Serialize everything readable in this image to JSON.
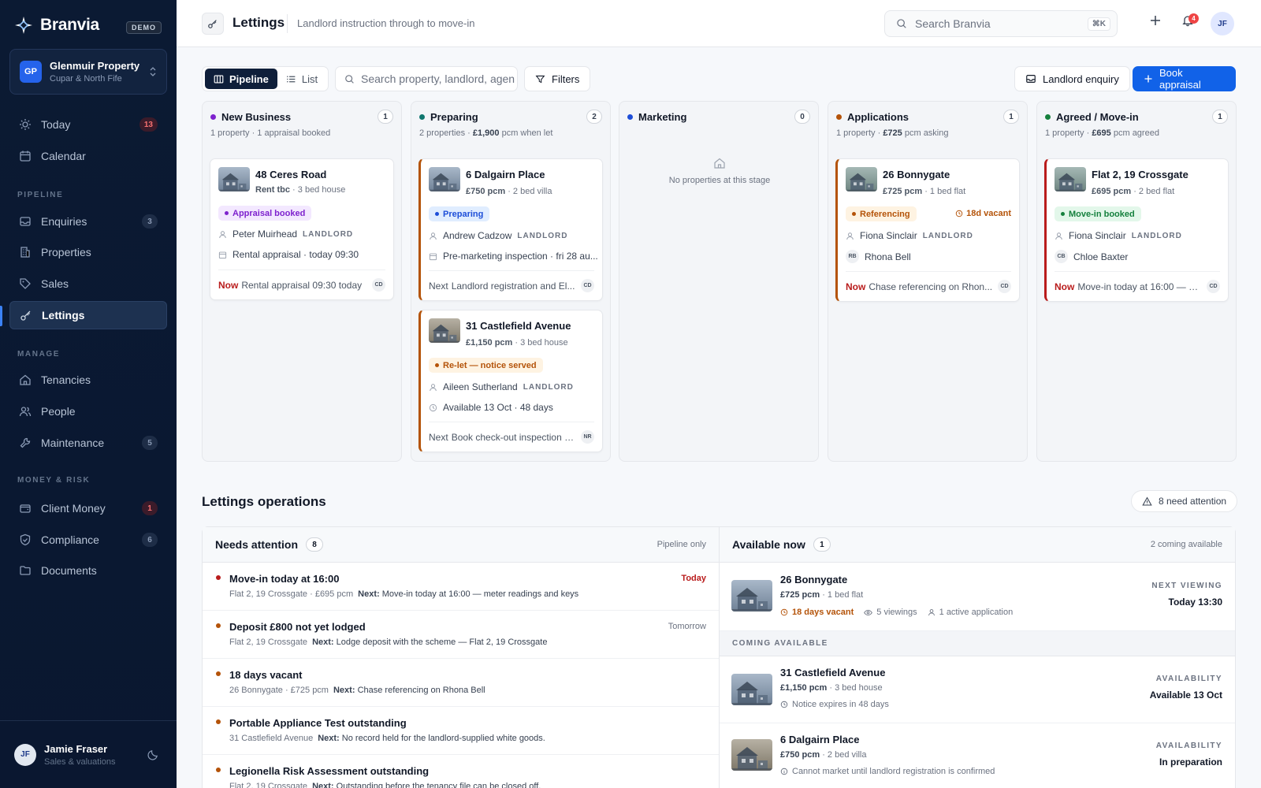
{
  "brand": {
    "name": "Branvia",
    "tag": "DEMO"
  },
  "org": {
    "initials": "GP",
    "name": "Glenmuir Property",
    "sub": "Cupar & North Fife"
  },
  "nav": {
    "today": {
      "label": "Today",
      "badge": "13"
    },
    "calendar": {
      "label": "Calendar"
    },
    "pipeline_header": "PIPELINE",
    "enquiries": {
      "label": "Enquiries",
      "badge": "3"
    },
    "properties": {
      "label": "Properties"
    },
    "sales": {
      "label": "Sales"
    },
    "lettings": {
      "label": "Lettings"
    },
    "manage_header": "MANAGE",
    "tenancies": {
      "label": "Tenancies"
    },
    "people": {
      "label": "People"
    },
    "maintenance": {
      "label": "Maintenance",
      "badge": "5"
    },
    "money_header": "MONEY & RISK",
    "client_money": {
      "label": "Client Money",
      "badge": "1"
    },
    "compliance": {
      "label": "Compliance",
      "badge": "6"
    },
    "documents": {
      "label": "Documents"
    }
  },
  "user": {
    "initials": "JF",
    "name": "Jamie Fraser",
    "role": "Sales & valuations"
  },
  "topbar": {
    "title": "Lettings",
    "subtitle": "Landlord instruction through to move-in",
    "search_placeholder": "Search Branvia",
    "shortcut": "⌘K",
    "notif_count": "4",
    "avatar": "JF"
  },
  "toolbar": {
    "pipeline": "Pipeline",
    "list": "List",
    "search_placeholder": "Search property, landlord, agent",
    "filters": "Filters",
    "landlord_enquiry": "Landlord enquiry",
    "book_appraisal": "Book appraisal"
  },
  "columns": [
    {
      "title": "New Business",
      "count": "1",
      "meta_a": "1 property · 1 appraisal booked",
      "meta_b": "",
      "meta_c": "",
      "color": "#7e22ce"
    },
    {
      "title": "Preparing",
      "count": "2",
      "meta_a": "2 properties · ",
      "meta_b": "£1,900",
      "meta_c": " pcm when let",
      "color": "#0f766e"
    },
    {
      "title": "Marketing",
      "count": "0",
      "meta_a": "",
      "meta_b": "",
      "meta_c": "",
      "color": "#1d4ed8",
      "empty": "No properties at this stage"
    },
    {
      "title": "Applications",
      "count": "1",
      "meta_a": "1 property · ",
      "meta_b": "£725",
      "meta_c": " pcm asking",
      "color": "#b45309"
    },
    {
      "title": "Agreed / Move-in",
      "count": "1",
      "meta_a": "1 property · ",
      "meta_b": "£695",
      "meta_c": " pcm agreed",
      "color": "#15803d"
    }
  ],
  "cards": {
    "ceres": {
      "title": "48 Ceres Road",
      "price": "Rent tbc",
      "detail": " · 3 bed house",
      "status": "Appraisal booked",
      "person": "Peter Muirhead",
      "role": "LANDLORD",
      "event": "Rental appraisal · today 09:30",
      "foot_label": "Now",
      "foot_text": "Rental appraisal 09:30 today",
      "agent": "CD"
    },
    "dalgairn": {
      "title": "6 Dalgairn Place",
      "price": "£750 pcm",
      "detail": " · 2 bed villa",
      "status": "Preparing",
      "person": "Andrew Cadzow",
      "role": "LANDLORD",
      "event": "Pre-marketing inspection · fri 28 au...",
      "foot_label": "Next",
      "foot_text": "Landlord registration and El...",
      "agent": "CD"
    },
    "castlefield": {
      "title": "31 Castlefield Avenue",
      "price": "£1,150 pcm",
      "detail": " · 3 bed house",
      "status": "Re-let — notice served",
      "person": "Aileen Sutherland",
      "role": "LANDLORD",
      "event": "Available 13 Oct · 48 days",
      "foot_label": "Next",
      "foot_text": "Book check-out inspection a...",
      "agent": "NR"
    },
    "bonnygate": {
      "title": "26 Bonnygate",
      "price": "£725 pcm",
      "detail": " · 1 bed flat",
      "status": "Referencing",
      "vacant": "18d vacant",
      "person": "Fiona Sinclair",
      "role": "LANDLORD",
      "applicant_initials": "RB",
      "applicant": "Rhona Bell",
      "foot_label": "Now",
      "foot_text": "Chase referencing on Rhon...",
      "agent": "CD"
    },
    "crossgate": {
      "title": "Flat 2, 19 Crossgate",
      "price": "£695 pcm",
      "detail": " · 2 bed flat",
      "status": "Move-in booked",
      "person": "Fiona Sinclair",
      "role": "LANDLORD",
      "applicant_initials": "CB",
      "applicant": "Chloe Baxter",
      "foot_label": "Now",
      "foot_text": "Move-in today at 16:00 — m...",
      "agent": "CD"
    }
  },
  "ops": {
    "title": "Lettings operations",
    "attention_btn": "8 need attention",
    "needs": {
      "title": "Needs attention",
      "count": "8",
      "right": "Pipeline only",
      "items": [
        {
          "title": "Move-in today at 16:00",
          "sub": "Flat 2, 19 Crossgate · £695 pcm",
          "next_label": "Next:",
          "next": "Move-in today at 16:00 — meter readings and keys",
          "when": "Today"
        },
        {
          "title": "Deposit £800 not yet lodged",
          "sub": "Flat 2, 19 Crossgate",
          "next_label": "Next:",
          "next": "Lodge deposit with the scheme — Flat 2, 19 Crossgate",
          "when": "Tomorrow"
        },
        {
          "title": "18 days vacant",
          "sub": "26 Bonnygate · £725 pcm",
          "next_label": "Next:",
          "next": "Chase referencing on Rhona Bell",
          "when": ""
        },
        {
          "title": "Portable Appliance Test outstanding",
          "sub": "31 Castlefield Avenue",
          "next_label": "Next:",
          "next": "No record held for the landlord-supplied white goods.",
          "when": ""
        },
        {
          "title": "Legionella Risk Assessment outstanding",
          "sub": "Flat 2, 19 Crossgate",
          "next_label": "Next:",
          "next": "Outstanding before the tenancy file can be closed off.",
          "when": ""
        }
      ]
    },
    "available": {
      "title": "Available now",
      "count": "1",
      "right": "2 coming available",
      "now": {
        "title": "26 Bonnygate",
        "price": "£725 pcm",
        "detail": " · 1 bed flat",
        "vacant": "18 days vacant",
        "viewings": "5 viewings",
        "applications": "1 active application",
        "rlabel": "NEXT VIEWING",
        "rvalue": "Today 13:30"
      },
      "coming_header": "COMING AVAILABLE",
      "coming": [
        {
          "title": "31 Castlefield Avenue",
          "price": "£1,150 pcm",
          "detail": " · 3 bed house",
          "note": "Notice expires in 48 days",
          "rlabel": "AVAILABILITY",
          "rvalue": "Available 13 Oct"
        },
        {
          "title": "6 Dalgairn Place",
          "price": "£750 pcm",
          "detail": " · 2 bed villa",
          "note": "Cannot market until landlord registration is confirmed",
          "rlabel": "AVAILABILITY",
          "rvalue": "In preparation"
        }
      ]
    }
  },
  "colors": {
    "accent": "#1162e8",
    "sidebar": "#0b1a33",
    "danger": "#b91c1c",
    "warning": "#b45309",
    "success": "#15803d"
  }
}
